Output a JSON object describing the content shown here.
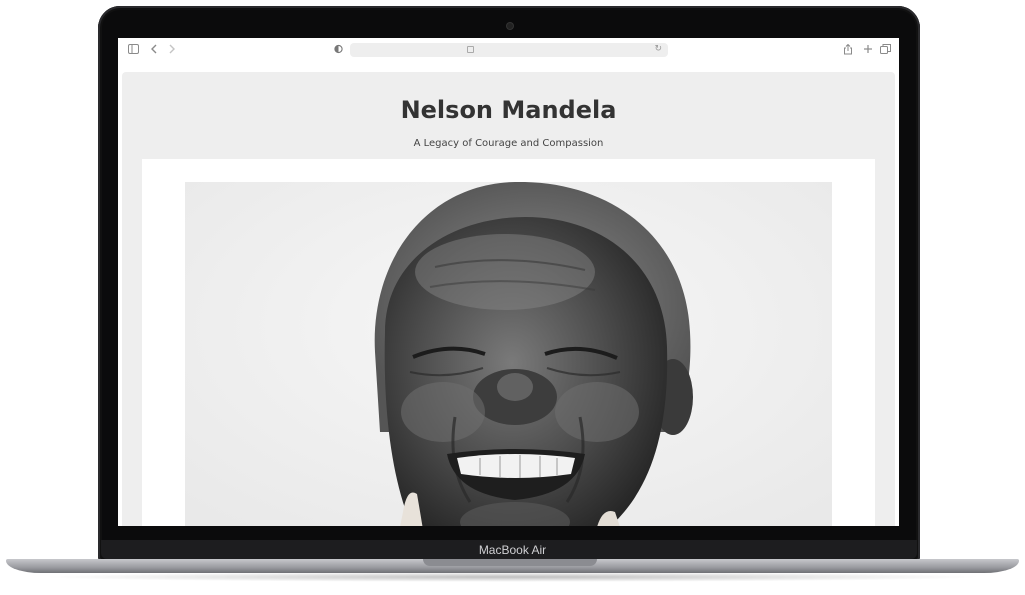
{
  "device": {
    "label": "MacBook Air"
  },
  "browser": {
    "url": ""
  },
  "page": {
    "title": "Nelson Mandela",
    "subtitle": "A Legacy of Courage and Compassion",
    "hero_image_alt": "Black-and-white portrait of Nelson Mandela smiling"
  }
}
